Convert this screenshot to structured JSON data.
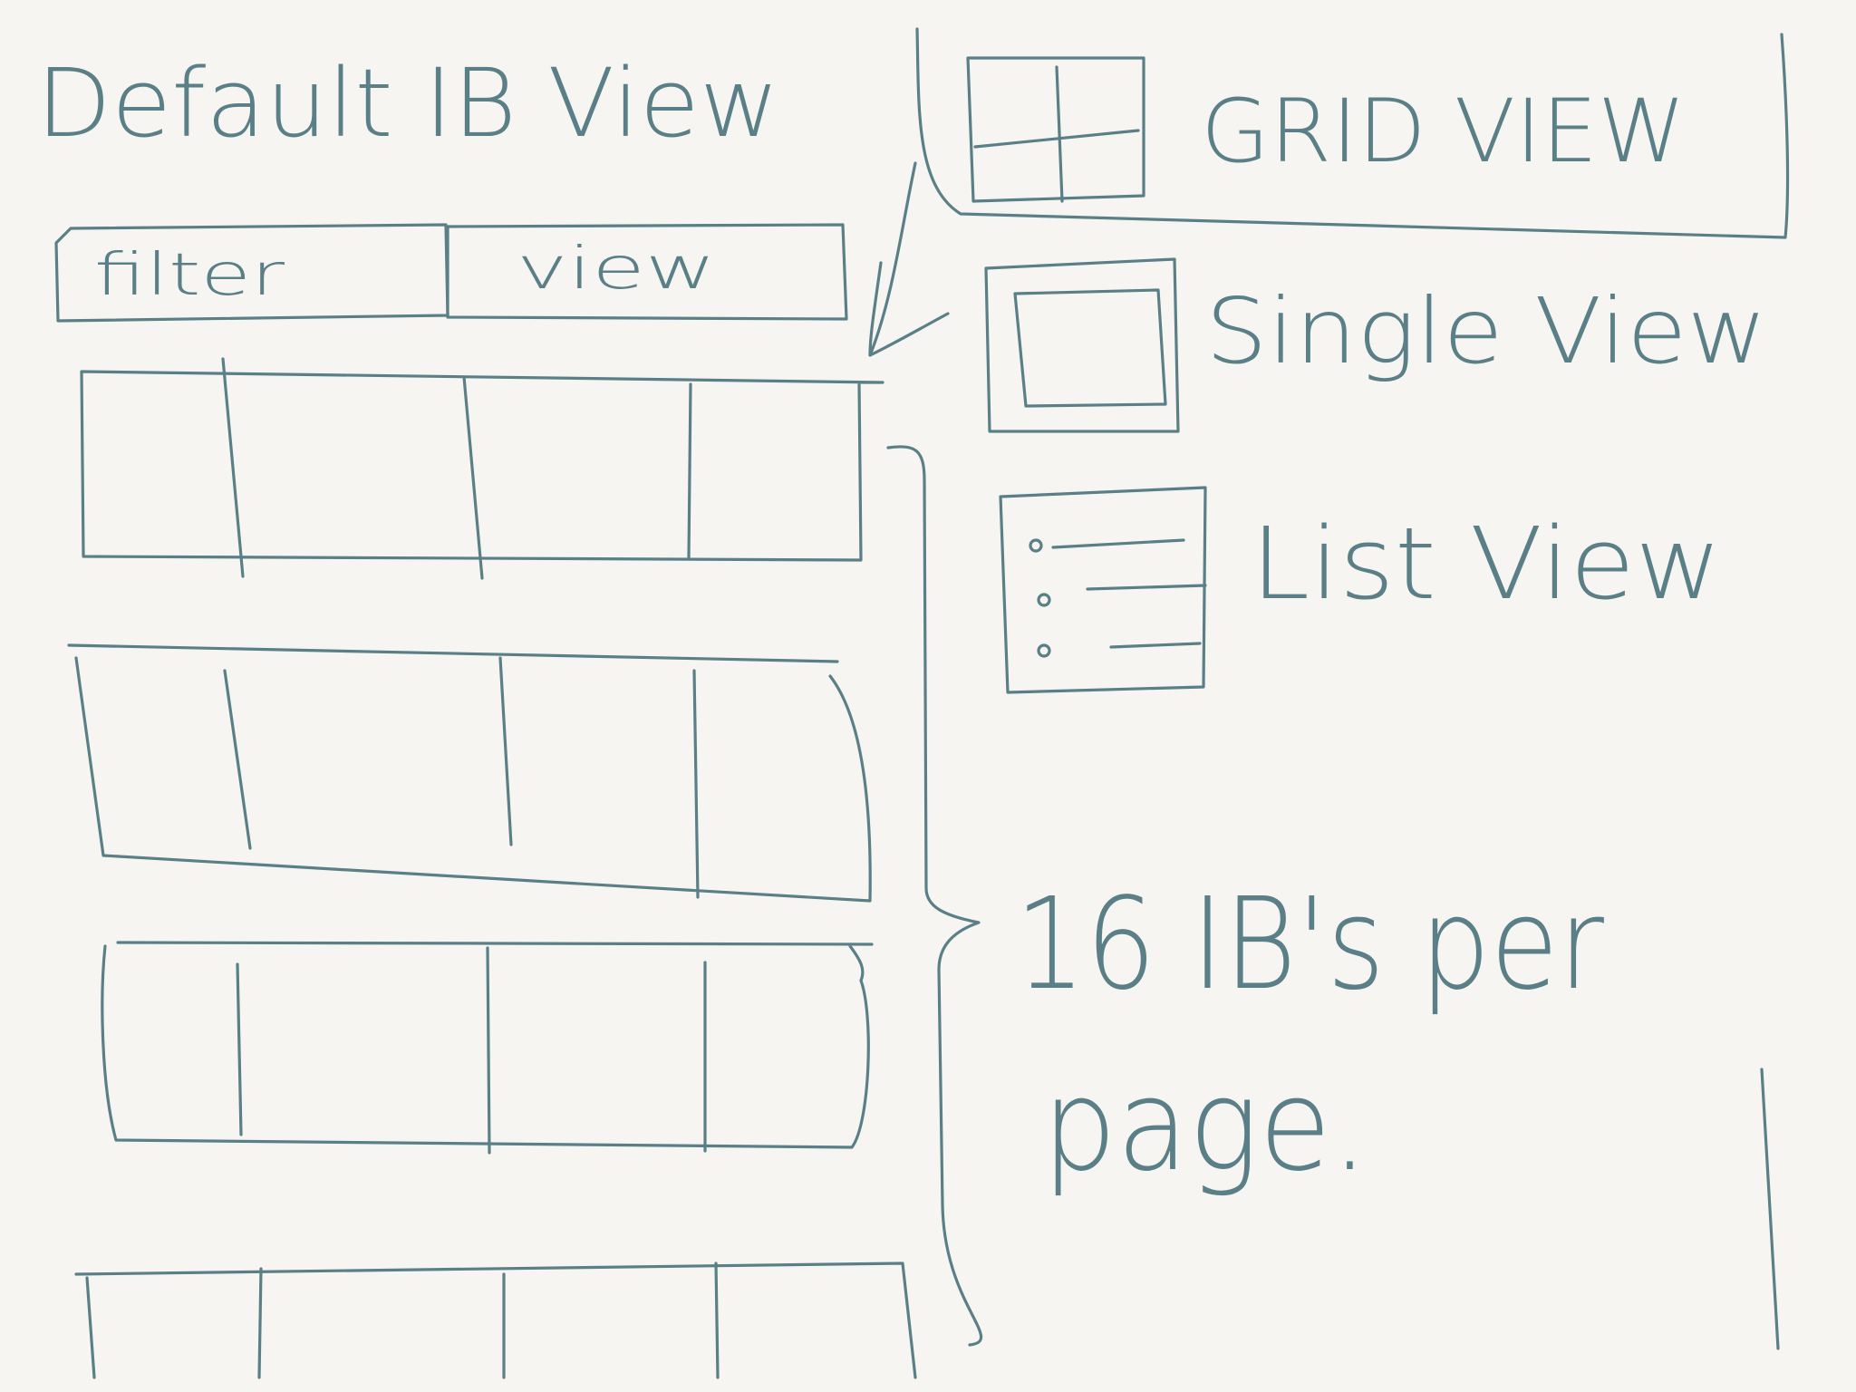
{
  "title": "Default IB View",
  "toolbar": {
    "filter_label": "filter",
    "view_label": "view"
  },
  "view_options": [
    {
      "label": "GRID VIEW",
      "icon": "grid-icon"
    },
    {
      "label": "Single View",
      "icon": "single-view-icon"
    },
    {
      "label": "List View",
      "icon": "list-view-icon"
    }
  ],
  "annotation": {
    "line1": "16 IB's per",
    "line2": "page."
  },
  "ink_color": "#5a7f86"
}
